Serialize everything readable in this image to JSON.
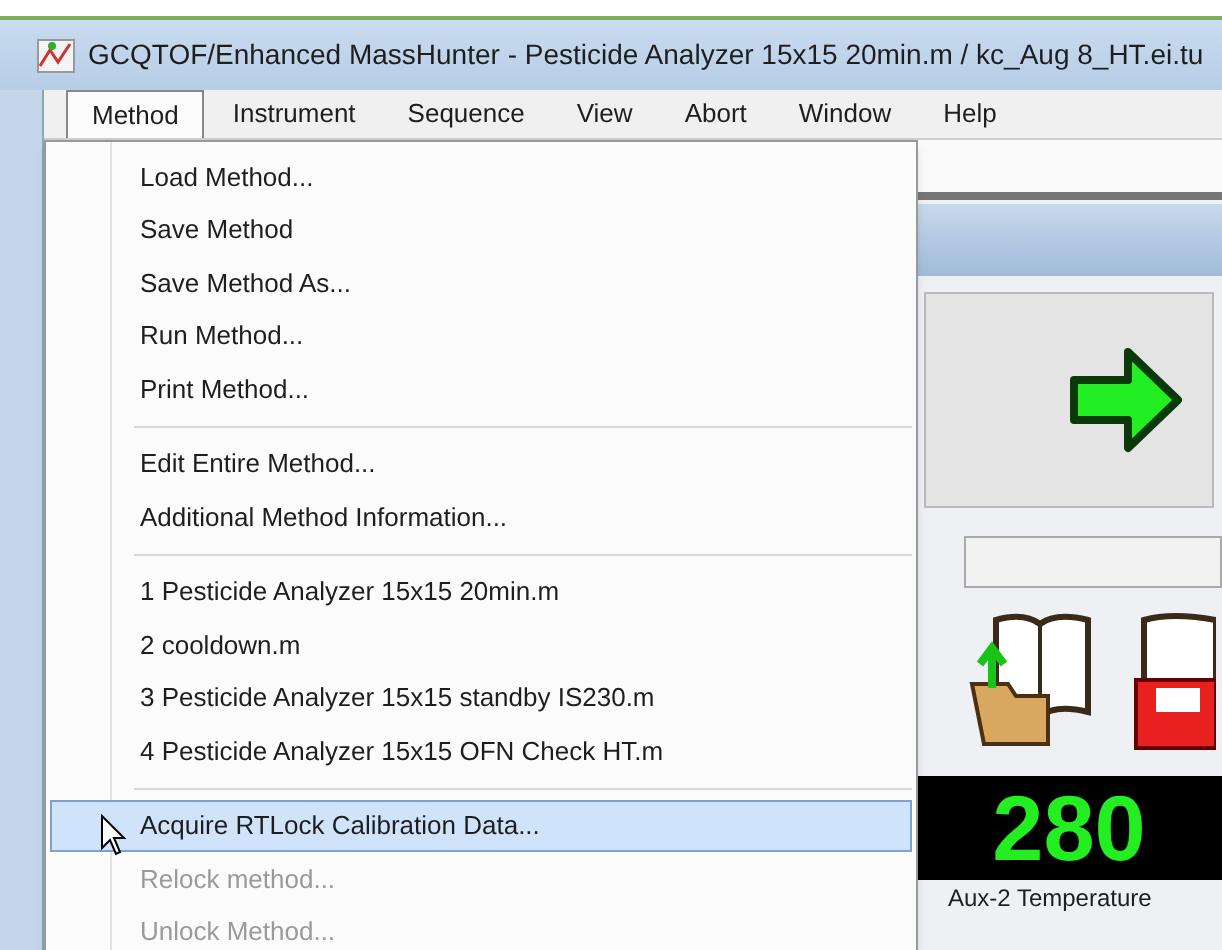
{
  "window": {
    "title": "GCQTOF/Enhanced MassHunter - Pesticide Analyzer 15x15 20min.m / kc_Aug 8_HT.ei.tu"
  },
  "menu_bar": [
    {
      "label": "Method",
      "selected": true
    },
    {
      "label": "Instrument",
      "selected": false
    },
    {
      "label": "Sequence",
      "selected": false
    },
    {
      "label": "View",
      "selected": false
    },
    {
      "label": "Abort",
      "selected": false
    },
    {
      "label": "Window",
      "selected": false
    },
    {
      "label": "Help",
      "selected": false
    }
  ],
  "dropdown": [
    {
      "kind": "item",
      "label": "Load Method...",
      "disabled": false,
      "selected": false
    },
    {
      "kind": "item",
      "label": "Save Method",
      "disabled": false,
      "selected": false
    },
    {
      "kind": "item",
      "label": "Save Method As...",
      "disabled": false,
      "selected": false
    },
    {
      "kind": "item",
      "label": "Run Method...",
      "disabled": false,
      "selected": false
    },
    {
      "kind": "item",
      "label": "Print Method...",
      "disabled": false,
      "selected": false
    },
    {
      "kind": "separator"
    },
    {
      "kind": "item",
      "label": "Edit Entire Method...",
      "disabled": false,
      "selected": false
    },
    {
      "kind": "item",
      "label": "Additional Method Information...",
      "disabled": false,
      "selected": false
    },
    {
      "kind": "separator"
    },
    {
      "kind": "item",
      "label": "1 Pesticide Analyzer 15x15 20min.m",
      "disabled": false,
      "selected": false
    },
    {
      "kind": "item",
      "label": "2 cooldown.m",
      "disabled": false,
      "selected": false
    },
    {
      "kind": "item",
      "label": "3 Pesticide Analyzer 15x15 standby IS230.m",
      "disabled": false,
      "selected": false
    },
    {
      "kind": "item",
      "label": "4 Pesticide Analyzer 15x15 OFN Check HT.m",
      "disabled": false,
      "selected": false
    },
    {
      "kind": "separator"
    },
    {
      "kind": "item",
      "label": "Acquire RTLock Calibration Data...",
      "disabled": false,
      "selected": true
    },
    {
      "kind": "item",
      "label": "Relock method...",
      "disabled": true,
      "selected": false
    },
    {
      "kind": "item",
      "label": "Unlock Method...",
      "disabled": true,
      "selected": false
    }
  ],
  "display": {
    "value": "280",
    "label": "Aux-2 Temperature"
  }
}
